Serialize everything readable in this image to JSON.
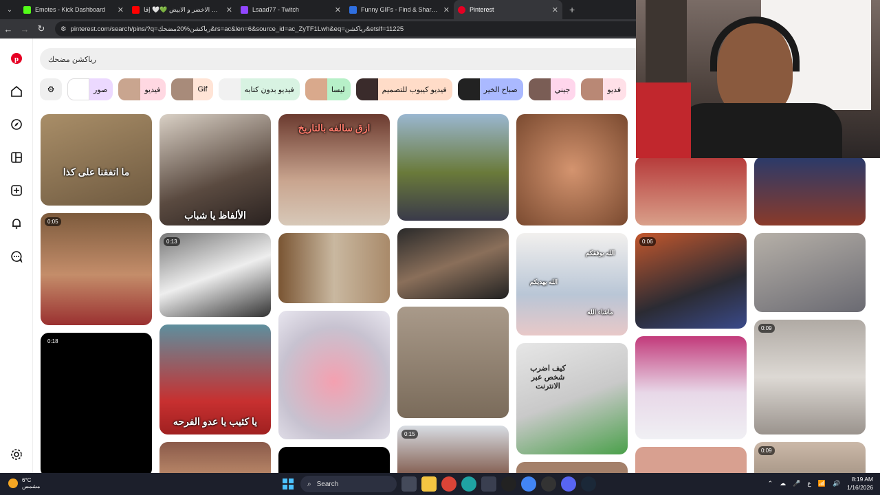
{
  "tabs": [
    {
      "title": "Emotes - Kick Dashboard",
      "color": "#53fc18"
    },
    {
      "title": "رفرف الاخضر و الابيض 💚🤍 إقا…",
      "color": "#ff0000"
    },
    {
      "title": "Lsaad77 - Twitch",
      "color": "#9146ff"
    },
    {
      "title": "Funny GIFs - Find & Share on G…",
      "color": "#2f6fe0"
    },
    {
      "title": "Pinterest",
      "color": "#e60023"
    }
  ],
  "url": "pinterest.com/search/pins/?q=رياكشن%20مضحك&rs=ac&len=6&source_id=ac_ZyTF1Lwh&eq=رياكشن&etslf=11225",
  "search": {
    "query": "رياكشن مضحك"
  },
  "chips": [
    {
      "label": "صور",
      "color": "#ecd9ff"
    },
    {
      "label": "فيديو",
      "color": "#ffd8e2"
    },
    {
      "label": "Gif",
      "color": "#ffe4d6"
    },
    {
      "label": "فيديو بدون كتابه",
      "color": "#d8f3e2"
    },
    {
      "label": "ليسا",
      "color": "#b7f0c8"
    },
    {
      "label": "فيديو كيبوب للتصميم",
      "color": "#ffdcc8"
    },
    {
      "label": "صباح الخير",
      "color": "#aab9ff"
    },
    {
      "label": "جيني",
      "color": "#ffd6ec"
    },
    {
      "label": "فديو",
      "color": "#ffe0e8"
    }
  ],
  "pins": [
    {
      "caption": "ما اتفقنا على كذا"
    },
    {
      "caption": "الألفاظ يا شباب"
    },
    {
      "caption": "ازق سالفه بالتاريخ"
    },
    {
      "caption": "كيف اضرب شخص عبر الانترنت"
    },
    {
      "caption": "يا كئيب يا عدو الفرحه"
    },
    {
      "caption": "الله يهديكم"
    },
    {
      "caption": "الله يوفقكم"
    },
    {
      "caption": "ماشاء الله"
    }
  ],
  "badges": [
    "0:05",
    "0:13",
    "0:18",
    "0:06",
    "0:09",
    "0:15",
    "0:09"
  ],
  "taskbar": {
    "temp": "6°C",
    "weather": "مشمس",
    "search": "Search",
    "time": "8:19 AM",
    "date": "1/16/2026",
    "lang": "ع"
  }
}
